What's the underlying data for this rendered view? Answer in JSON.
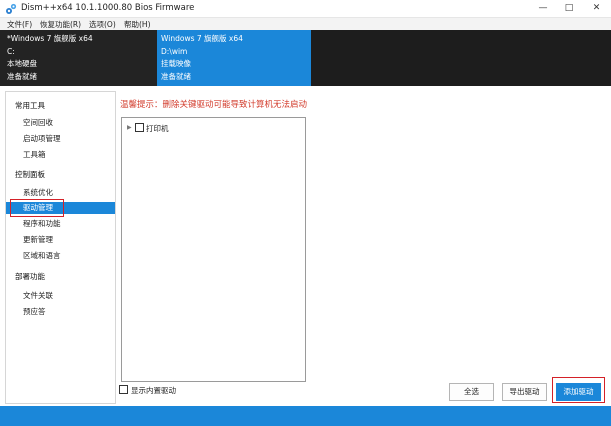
{
  "window": {
    "title": "Dism++x64 10.1.1000.80 Bios Firmware",
    "minimize": "—",
    "maximize": "□",
    "close": "✕"
  },
  "menu": [
    "文件(F)",
    "恢复功能(R)",
    "选项(O)",
    "帮助(H)"
  ],
  "images": [
    {
      "lines": [
        "*Windows 7 旗舰版 x64",
        "C:",
        "本地硬盘",
        "准备就绪"
      ]
    },
    {
      "lines": [
        "Windows 7 旗舰版 x64",
        "D:\\wim",
        "挂载映像",
        "准备就绪"
      ]
    }
  ],
  "sidebar": {
    "groups": [
      {
        "title": "常用工具",
        "items": [
          "空间回收",
          "启动项管理",
          "工具箱"
        ]
      },
      {
        "title": "控制面板",
        "items": [
          "系统优化",
          "驱动管理",
          "程序和功能",
          "更新管理",
          "区域和语言"
        ]
      },
      {
        "title": "部署功能",
        "items": [
          "文件关联",
          "预应答"
        ]
      }
    ],
    "active_item": "驱动管理"
  },
  "main": {
    "warning": "温馨提示：删除关键驱动可能导致计算机无法启动",
    "tree": [
      {
        "label": "打印机",
        "checked": false
      }
    ],
    "show_builtin": {
      "label": "显示内置驱动",
      "checked": false
    },
    "buttons": {
      "select_all": "全选",
      "export": "导出驱动",
      "add": "添加驱动"
    }
  },
  "colors": {
    "accent": "#1b87d9",
    "warning": "#d23a2a",
    "highlight_box": "#d42128"
  }
}
